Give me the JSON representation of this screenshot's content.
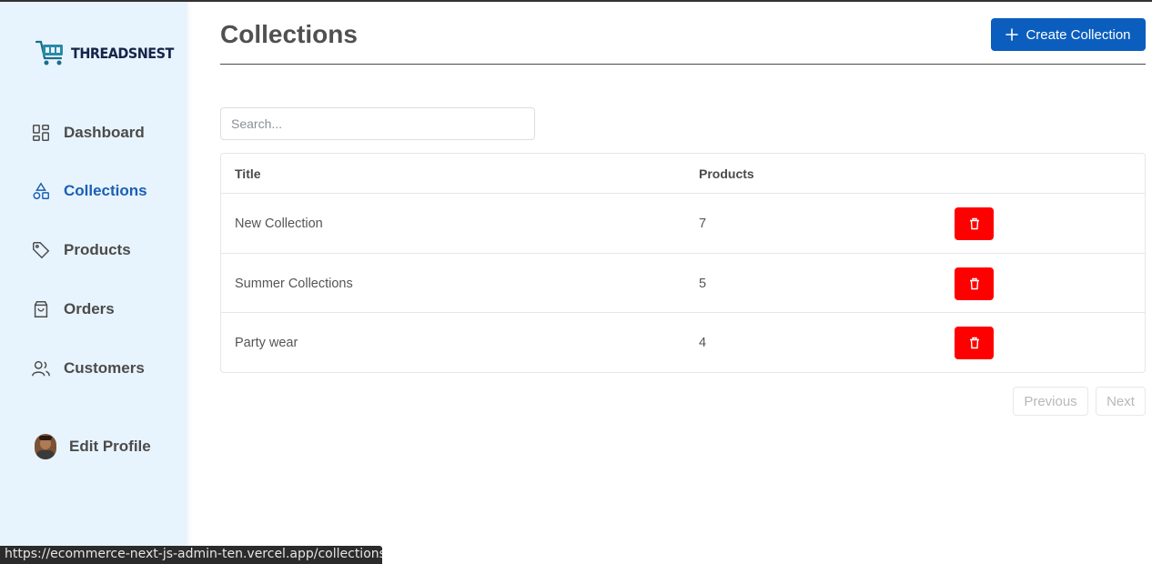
{
  "brand": {
    "name": "THREADSNEST"
  },
  "sidebar": {
    "items": [
      {
        "label": "Dashboard",
        "icon": "dashboard-icon",
        "active": false
      },
      {
        "label": "Collections",
        "icon": "shapes-icon",
        "active": true
      },
      {
        "label": "Products",
        "icon": "tag-icon",
        "active": false
      },
      {
        "label": "Orders",
        "icon": "shopping-bag-icon",
        "active": false
      },
      {
        "label": "Customers",
        "icon": "users-icon",
        "active": false
      }
    ],
    "profile_label": "Edit Profile"
  },
  "header": {
    "title": "Collections",
    "create_label": "Create Collection"
  },
  "search": {
    "placeholder": "Search..."
  },
  "table": {
    "columns": [
      "Title",
      "Products"
    ],
    "rows": [
      {
        "title": "New Collection",
        "products": "7"
      },
      {
        "title": "Summer Collections",
        "products": "5"
      },
      {
        "title": "Party wear",
        "products": "4"
      }
    ]
  },
  "pagination": {
    "previous": "Previous",
    "next": "Next"
  },
  "status_bar": {
    "url": "https://ecommerce-next-js-admin-ten.vercel.app/collections"
  },
  "colors": {
    "accent": "#0b5ebd",
    "sidebar_bg": "#e8f4fd",
    "delete": "#ff0000",
    "active_nav": "#1a5fb4"
  }
}
